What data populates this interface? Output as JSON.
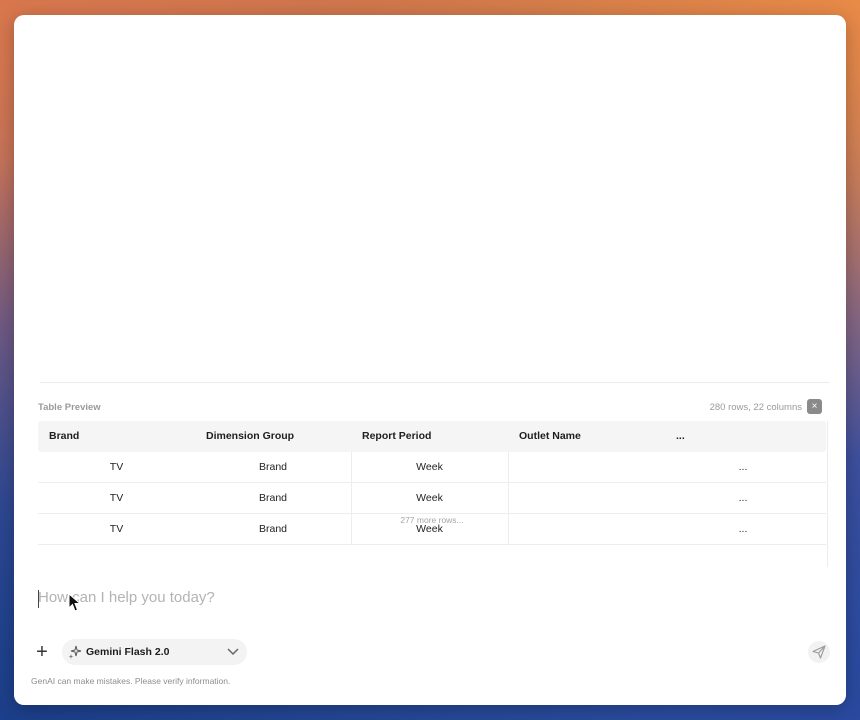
{
  "table_preview": {
    "title": "Table Preview",
    "meta": "280 rows, 22 columns",
    "close_glyph": "×",
    "columns": [
      "Brand",
      "Dimension Group",
      "Report Period",
      "Outlet Name",
      "..."
    ],
    "rows": [
      [
        "TV",
        "Brand",
        "Week",
        "",
        "..."
      ],
      [
        "TV",
        "Brand",
        "Week",
        "",
        "..."
      ],
      [
        "TV",
        "Brand",
        "Week",
        "",
        "..."
      ]
    ],
    "more_rows": "277 more rows..."
  },
  "composer": {
    "placeholder": "How can I help you today?",
    "add_glyph": "+",
    "model": "Gemini Flash 2.0",
    "model_icon": "sparkle-icon",
    "send_icon": "send-icon"
  },
  "disclaimer": "GenAI can make mistakes. Please verify information.",
  "colors": {
    "accent_text": "#1e1e1e",
    "muted_text": "#9a9a9a",
    "header_bg": "#f5f5f5"
  }
}
